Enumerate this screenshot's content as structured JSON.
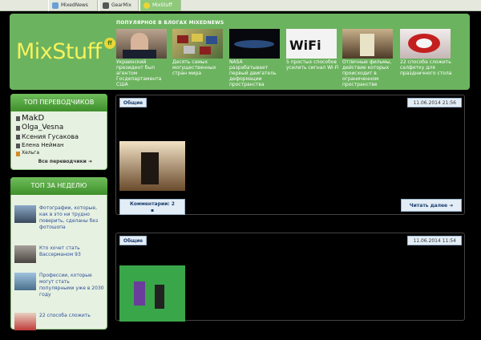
{
  "topbar": {
    "tabs": [
      {
        "label": "MixedNews",
        "icon": "mixednews-icon",
        "active": false
      },
      {
        "label": "GearMix",
        "icon": "gearmix-icon",
        "active": false
      },
      {
        "label": "MixStuff",
        "icon": "mixstuff-icon",
        "active": true
      }
    ]
  },
  "header": {
    "logo": "MixStuff",
    "logo_badge": "ff",
    "blogs_title": "ПОПУЛЯРНОЕ В БЛОГАХ MIXEDNEWS",
    "blogs": [
      {
        "caption": "Украинский президент был агентом Госдепартамента США"
      },
      {
        "caption": "Десять самых могущественных стран мира"
      },
      {
        "caption": "NASA разрабатывает первый двигатель деформации пространства"
      },
      {
        "caption": "5 простых способов усилить сигнал Wi-Fi"
      },
      {
        "caption": "Отличные фильмы, действие которых происходит в ограниченном пространстве"
      },
      {
        "caption": "22 способа сложить салфетку для праздничного стола"
      }
    ]
  },
  "translators": {
    "heading": "ТОП ПЕРЕВОДЧИКОВ",
    "names": [
      "MakD",
      "Olga_Vesna",
      "Ксения Гусакова",
      "Елена Нейман",
      "Хельга"
    ],
    "more": "Все переводчики"
  },
  "week": {
    "heading": "ТОП ЗА НЕДЕЛЮ",
    "items": [
      {
        "text": "Фотографии, которые, как в это ни трудно поверить, сделаны без фотошопа"
      },
      {
        "text": "Кто хочет стать Вассерманом 93"
      },
      {
        "text": "Профессии, которые могут стать популярными уже в 2030 году"
      },
      {
        "text": "22 способа сложить"
      }
    ]
  },
  "posts": [
    {
      "category": "Общие",
      "date": "11.06.2014 21:56",
      "comments_label": "Комментарии: 2",
      "more": "Читать далее"
    },
    {
      "category": "Общие",
      "date": "11.06.2014 11:54"
    }
  ],
  "colors": {
    "header_green": "#6cb35f",
    "logo_yellow": "#f4f25c",
    "link_blue": "#1f4e86"
  }
}
